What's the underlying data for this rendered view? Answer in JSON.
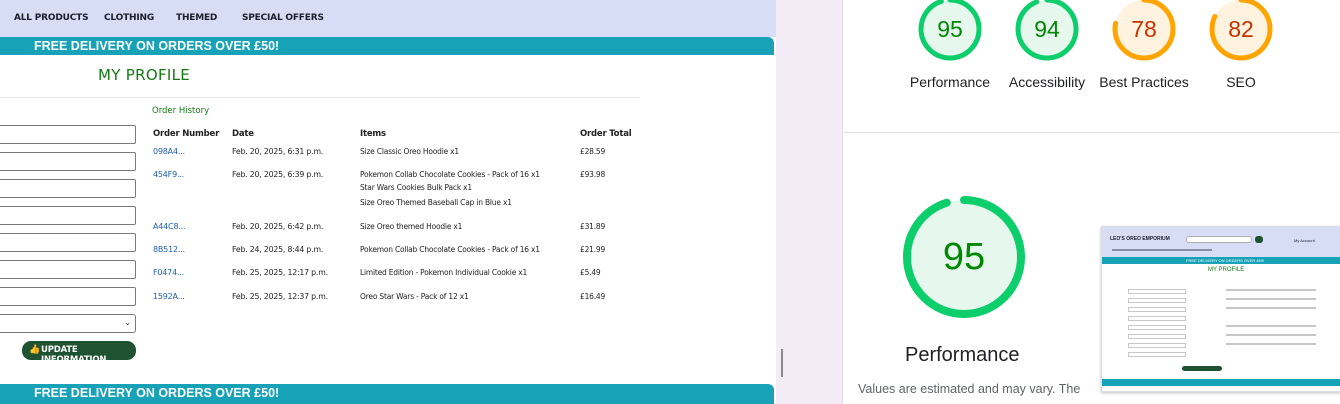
{
  "site": {
    "nav": [
      "ALL PRODUCTS",
      "CLOTHING",
      "THEMED",
      "SPECIAL OFFERS"
    ],
    "delivery_banner": "FREE DELIVERY ON ORDERS OVER £50!",
    "page_title": "MY PROFILE",
    "update_button": "UPDATE INFORMATION",
    "order_history": {
      "title": "Order History",
      "headers": [
        "Order Number",
        "Date",
        "Items",
        "Order Total"
      ],
      "rows": [
        {
          "number": "098A4...",
          "date": "Feb. 20, 2025, 6:31 p.m.",
          "items": [
            "Size Classic Oreo Hoodie x1"
          ],
          "total": "£28.59"
        },
        {
          "number": "454F9...",
          "date": "Feb. 20, 2025, 6:39 p.m.",
          "items": [
            "Pokemon Collab Chocolate Cookies - Pack of 16 x1",
            "Star Wars Cookies Bulk Pack x1",
            "Size Oreo Themed Baseball Cap in Blue x1"
          ],
          "total": "£93.98"
        },
        {
          "number": "A44C8...",
          "date": "Feb. 20, 2025, 6:42 p.m.",
          "items": [
            "Size Oreo themed Hoodie x1"
          ],
          "total": "£31.89"
        },
        {
          "number": "8B512...",
          "date": "Feb. 24, 2025, 8:44 p.m.",
          "items": [
            "Pokemon Collab Chocolate Cookies - Pack of 16 x1"
          ],
          "total": "£21.99"
        },
        {
          "number": "F0474...",
          "date": "Feb. 25, 2025, 12:17 p.m.",
          "items": [
            "Limited Edition - Pokemon Individual Cookie x1"
          ],
          "total": "£5.49"
        },
        {
          "number": "1592A...",
          "date": "Feb. 25, 2025, 12:37 p.m.",
          "items": [
            "Oreo Star Wars - Pack of 12 x1"
          ],
          "total": "£16.49"
        }
      ]
    }
  },
  "lighthouse": {
    "scores": [
      {
        "label": "Performance",
        "value": "95",
        "score": 95,
        "status": "pass"
      },
      {
        "label": "Accessibility",
        "value": "94",
        "score": 94,
        "status": "pass"
      },
      {
        "label": "Best Practices",
        "value": "78",
        "score": 78,
        "status": "average"
      },
      {
        "label": "SEO",
        "value": "82",
        "score": 82,
        "status": "average"
      }
    ],
    "main_score": {
      "value": "95",
      "score": 95,
      "label": "Performance"
    },
    "note": "Values are estimated and may vary. The",
    "colors": {
      "pass": "#0cce6b",
      "pass_fill": "#e6f8ee",
      "pass_text": "#008800",
      "average": "#ffa400",
      "average_fill": "#fff3e0",
      "average_text": "#c33300"
    },
    "thumbnail": {
      "logo": "LEO'S OREO EMPORIUM",
      "account": "My Account",
      "banner": "FREE DELIVERY ON ORDERS OVER £50!",
      "title": "MY PROFILE"
    }
  }
}
